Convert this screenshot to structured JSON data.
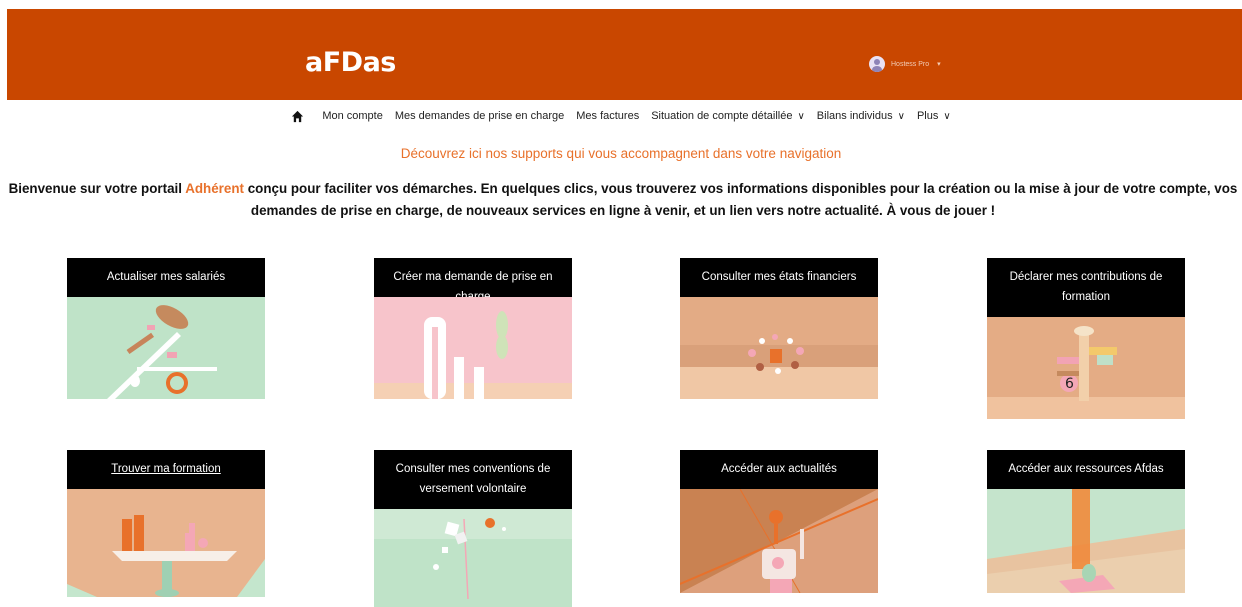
{
  "header": {
    "logo": "aFDas",
    "user_name": "Hostess Pro",
    "caret": "▾",
    "brand_color": "#c94700"
  },
  "nav": {
    "items": [
      {
        "label": "Mon compte",
        "dropdown": false
      },
      {
        "label": "Mes demandes de prise en charge",
        "dropdown": false
      },
      {
        "label": "Mes factures",
        "dropdown": false
      },
      {
        "label": "Situation de compte détaillée",
        "dropdown": true
      },
      {
        "label": "Bilans individus",
        "dropdown": true
      },
      {
        "label": "Plus",
        "dropdown": true
      }
    ],
    "chevron": "∨"
  },
  "discover_text": "Découvrez ici nos supports qui vous accompagnent dans votre navigation",
  "welcome": {
    "before": "Bienvenue sur votre portail ",
    "highlight": "Adhérent",
    "after": " conçu pour faciliter vos démarches. En quelques clics, vous trouverez vos informations disponibles pour la création ou la mise à jour de votre compte, vos demandes de prise en charge, de nouveaux services en ligne à venir, et un lien vers notre actualité. À vous de jouer !"
  },
  "accent_color": "#e8712b",
  "cards": [
    {
      "title": "Actualiser mes salariés"
    },
    {
      "title": "Créer ma demande de prise en charge"
    },
    {
      "title": "Consulter mes états financiers"
    },
    {
      "title": "Déclarer mes contributions de formation"
    },
    {
      "title": "Trouver ma formation"
    },
    {
      "title": "Consulter mes conventions de versement volontaire"
    },
    {
      "title": "Accéder aux actualités"
    },
    {
      "title": "Accéder aux ressources Afdas"
    }
  ]
}
